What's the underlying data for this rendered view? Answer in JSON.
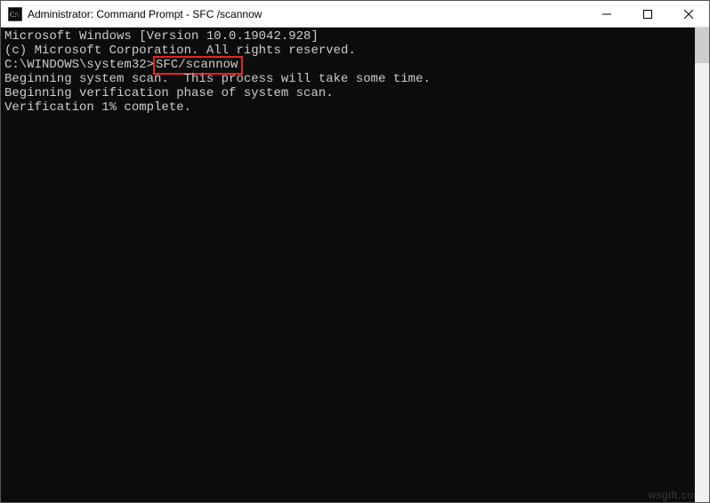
{
  "titlebar": {
    "title": "Administrator: Command Prompt - SFC /scannow"
  },
  "terminal": {
    "line1": "Microsoft Windows [Version 10.0.19042.928]",
    "line2": "(c) Microsoft Corporation. All rights reserved.",
    "blank1": "",
    "prompt": "C:\\WINDOWS\\system32>",
    "command": "SFC/scannow",
    "blank2": "",
    "line4": "Beginning system scan.  This process will take some time.",
    "blank3": "",
    "line5": "Beginning verification phase of system scan.",
    "line6": "Verification 1% complete."
  },
  "watermark": "wsgift.com"
}
